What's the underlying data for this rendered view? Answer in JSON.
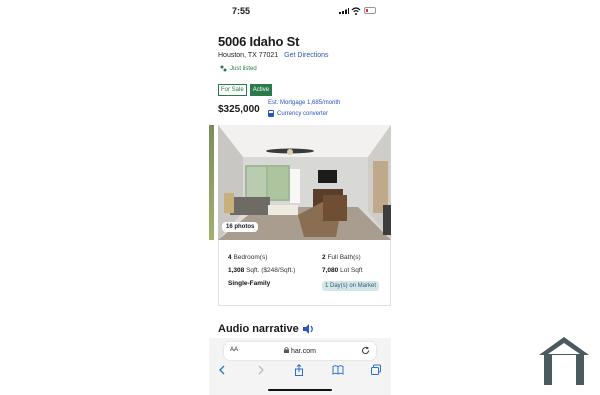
{
  "status_bar": {
    "time": "7:55"
  },
  "listing": {
    "address": "5006 Idaho St",
    "city": "Houston, TX 77021",
    "directions": "Get Directions",
    "listed_status": "Just listed",
    "badges": [
      "For Sale",
      "Active"
    ],
    "price": "$325,000",
    "mortgage": "Est. Mortgage 1,685/month",
    "currency_converter": "Currency converter",
    "photos_count": "16 photos"
  },
  "facts": {
    "bedrooms_num": "4",
    "bedrooms_label": "Bedroom(s)",
    "baths_num": "2",
    "baths_label": "Full Bath(s)",
    "sqft_num": "1,308",
    "sqft_label": "Sqft. ($248/Sqft.)",
    "lot_num": "7,080",
    "lot_label": "Lot Sqft",
    "type": "Single-Family",
    "market": "1 Day(s) on Market"
  },
  "section_heading": "Audio narrative",
  "browser": {
    "text_size": "AA",
    "url": "har.com"
  },
  "colors": {
    "accent_green": "#2b7a4b",
    "link_blue": "#2b55c4",
    "market_badge_bg": "#d3e6ea"
  },
  "icons": [
    "signal-icon",
    "wifi-icon",
    "battery-icon",
    "just-listed-icon",
    "calculator-icon",
    "speaker-icon",
    "lock-icon",
    "reload-icon",
    "back-icon",
    "forward-icon",
    "share-icon",
    "bookmarks-icon",
    "tabs-icon",
    "house-logo"
  ]
}
